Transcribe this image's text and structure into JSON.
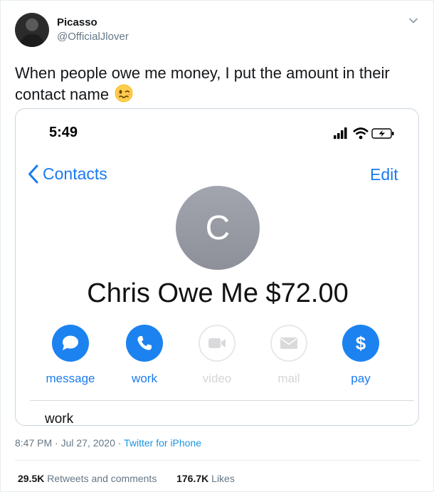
{
  "author": {
    "display_name": "Picasso",
    "handle": "@OfficialJlover"
  },
  "tweet": {
    "text": "When people owe me money, I put the amount in their contact name",
    "emoji": "woozy-face-emoji"
  },
  "screenshot": {
    "status_time": "5:49",
    "back_label": "Contacts",
    "edit_label": "Edit",
    "avatar_initial": "C",
    "contact_name": "Chris Owe Me $72.00",
    "actions": [
      {
        "label": "message",
        "icon": "message-bubble-icon",
        "enabled": true
      },
      {
        "label": "work",
        "icon": "phone-icon",
        "enabled": true
      },
      {
        "label": "video",
        "icon": "video-camera-icon",
        "enabled": false
      },
      {
        "label": "mail",
        "icon": "mail-envelope-icon",
        "enabled": false
      },
      {
        "label": "pay",
        "icon": "dollar-icon",
        "enabled": true
      }
    ],
    "section_peek": "work",
    "accent_color": "#1a7bf0"
  },
  "meta": {
    "time": "8:47 PM",
    "separator": " · ",
    "date": "Jul 27, 2020",
    "source": "Twitter for iPhone"
  },
  "stats": {
    "retweets": "29.5K",
    "retweets_label": " Retweets and comments",
    "likes": "176.7K",
    "likes_label": " Likes"
  }
}
